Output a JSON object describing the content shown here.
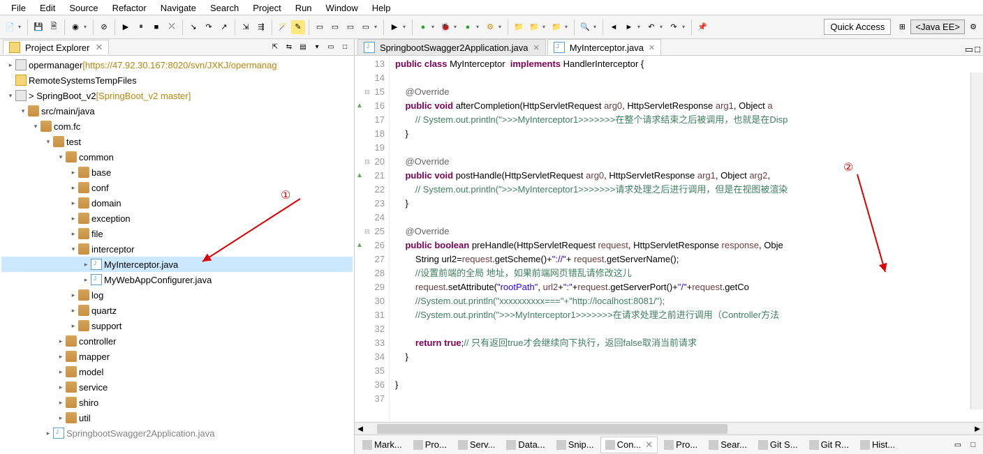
{
  "menu": [
    "File",
    "Edit",
    "Source",
    "Refactor",
    "Navigate",
    "Search",
    "Project",
    "Run",
    "Window",
    "Help"
  ],
  "quick_access": "Quick Access",
  "perspective": "<Java EE>",
  "explorer": {
    "title": "Project Explorer",
    "items": [
      {
        "depth": 0,
        "twisty": ">",
        "icon": "proj",
        "label": "opermanager",
        "suffix": "[https://47.92.30.167:8020/svn/JXKJ/opermanag",
        "suffix_class": "branch-info"
      },
      {
        "depth": 0,
        "twisty": "",
        "icon": "folder",
        "label": "RemoteSystemsTempFiles"
      },
      {
        "depth": 0,
        "twisty": "v",
        "icon": "proj",
        "label": "> SpringBoot_v2",
        "suffix": "[SpringBoot_v2 master]",
        "suffix_class": "branch-info"
      },
      {
        "depth": 1,
        "twisty": "v",
        "icon": "pkg",
        "label": "src/main/java"
      },
      {
        "depth": 2,
        "twisty": "v",
        "icon": "pkg",
        "label": "com.fc"
      },
      {
        "depth": 3,
        "twisty": "v",
        "icon": "pkg",
        "label": "test"
      },
      {
        "depth": 4,
        "twisty": "v",
        "icon": "pkg",
        "label": "common"
      },
      {
        "depth": 5,
        "twisty": ">",
        "icon": "pkg",
        "label": "base"
      },
      {
        "depth": 5,
        "twisty": ">",
        "icon": "pkg",
        "label": "conf"
      },
      {
        "depth": 5,
        "twisty": ">",
        "icon": "pkg",
        "label": "domain"
      },
      {
        "depth": 5,
        "twisty": ">",
        "icon": "pkg",
        "label": "exception"
      },
      {
        "depth": 5,
        "twisty": ">",
        "icon": "pkg",
        "label": "file"
      },
      {
        "depth": 5,
        "twisty": "v",
        "icon": "pkg",
        "label": "interceptor"
      },
      {
        "depth": 6,
        "twisty": ">",
        "icon": "java",
        "label": "MyInterceptor.java",
        "selected": true
      },
      {
        "depth": 6,
        "twisty": ">",
        "icon": "java",
        "label": "MyWebAppConfigurer.java"
      },
      {
        "depth": 5,
        "twisty": ">",
        "icon": "pkg",
        "label": "log"
      },
      {
        "depth": 5,
        "twisty": ">",
        "icon": "pkg",
        "label": "quartz"
      },
      {
        "depth": 5,
        "twisty": ">",
        "icon": "pkg",
        "label": "support"
      },
      {
        "depth": 4,
        "twisty": ">",
        "icon": "pkg",
        "label": "controller"
      },
      {
        "depth": 4,
        "twisty": ">",
        "icon": "pkg",
        "label": "mapper"
      },
      {
        "depth": 4,
        "twisty": ">",
        "icon": "pkg",
        "label": "model"
      },
      {
        "depth": 4,
        "twisty": ">",
        "icon": "pkg",
        "label": "service"
      },
      {
        "depth": 4,
        "twisty": ">",
        "icon": "pkg",
        "label": "shiro"
      },
      {
        "depth": 4,
        "twisty": ">",
        "icon": "pkg",
        "label": "util"
      },
      {
        "depth": 3,
        "twisty": ">",
        "icon": "java",
        "label": "SpringbootSwagger2Application.java",
        "cut": true
      }
    ]
  },
  "editor": {
    "tabs": [
      {
        "label": "SpringbootSwagger2Application.java",
        "active": false
      },
      {
        "label": "MyInterceptor.java",
        "active": true
      }
    ],
    "lines": [
      {
        "n": 13,
        "html": "<span class='kw'>public</span> <span class='kw'>class</span> MyInterceptor  <span class='kw'>implements</span> HandlerInterceptor {"
      },
      {
        "n": 14,
        "html": ""
      },
      {
        "n": 15,
        "html": "    <span class='ann'>@Override</span>",
        "fold": "-"
      },
      {
        "n": 16,
        "html": "    <span class='kw'>public</span> <span class='kw'>void</span> afterCompletion(HttpServletRequest <span class='param'>arg0</span>, HttpServletResponse <span class='param'>arg1</span>, Object <span class='param'>a</span>",
        "ov": true
      },
      {
        "n": 17,
        "html": "        <span class='comm'>// System.out.println(\">>>MyInterceptor1>>>>>>>在整个请求结束之后被调用，也就是在Disp</span>"
      },
      {
        "n": 18,
        "html": "    }"
      },
      {
        "n": 19,
        "html": ""
      },
      {
        "n": 20,
        "html": "    <span class='ann'>@Override</span>",
        "fold": "-"
      },
      {
        "n": 21,
        "html": "    <span class='kw'>public</span> <span class='kw'>void</span> postHandle(HttpServletRequest <span class='param'>arg0</span>, HttpServletResponse <span class='param'>arg1</span>, Object <span class='param'>arg2</span>,",
        "ov": true
      },
      {
        "n": 22,
        "html": "        <span class='comm'>// System.out.println(\">>>MyInterceptor1>>>>>>>请求处理之后进行调用，但是在视图被渲染</span>"
      },
      {
        "n": 23,
        "html": "    }"
      },
      {
        "n": 24,
        "html": ""
      },
      {
        "n": 25,
        "html": "    <span class='ann'>@Override</span>",
        "fold": "-"
      },
      {
        "n": 26,
        "html": "    <span class='kw'>public</span> <span class='kw'>boolean</span> preHandle(HttpServletRequest <span class='param'>request</span>, HttpServletResponse <span class='param'>response</span>, Obje",
        "ov": true
      },
      {
        "n": 27,
        "html": "        String url2=<span class='param'>request</span>.getScheme()+<span class='str'>\"://\"</span>+ <span class='param'>request</span>.getServerName();"
      },
      {
        "n": 28,
        "html": "        <span class='comm'>//设置前端的全局 地址，如果前端网页错乱请修改这儿</span>"
      },
      {
        "n": 29,
        "html": "        <span class='param'>request</span>.setAttribute(<span class='str'>\"rootPath\"</span>, <span class='param'>url2</span>+<span class='str'>\":\"</span>+<span class='param'>request</span>.getServerPort()+<span class='str'>\"/\"</span>+<span class='param'>request</span>.getCo"
      },
      {
        "n": 30,
        "html": "        <span class='comm'>//System.out.println(\"xxxxxxxxxx===\"+\"http://localhost:8081/\");</span>"
      },
      {
        "n": 31,
        "html": "        <span class='comm'>//System.out.println(\">>>MyInterceptor1>>>>>>>在请求处理之前进行调用（Controller方法</span>"
      },
      {
        "n": 32,
        "html": ""
      },
      {
        "n": 33,
        "html": "        <span class='kw'>return</span> <span class='kw'>true</span>;<span class='comm'>// 只有返回true才会继续向下执行，返回false取消当前请求</span>"
      },
      {
        "n": 34,
        "html": "    }"
      },
      {
        "n": 35,
        "html": ""
      },
      {
        "n": 36,
        "html": "}"
      },
      {
        "n": 37,
        "html": ""
      }
    ]
  },
  "bottom_views": [
    "Mark...",
    "Pro...",
    "Serv...",
    "Data...",
    "Snip...",
    "Con...",
    "Pro...",
    "Sear...",
    "Git S...",
    "Git R...",
    "Hist..."
  ],
  "bottom_active": 5,
  "annotations": {
    "one": "①",
    "two": "②"
  }
}
